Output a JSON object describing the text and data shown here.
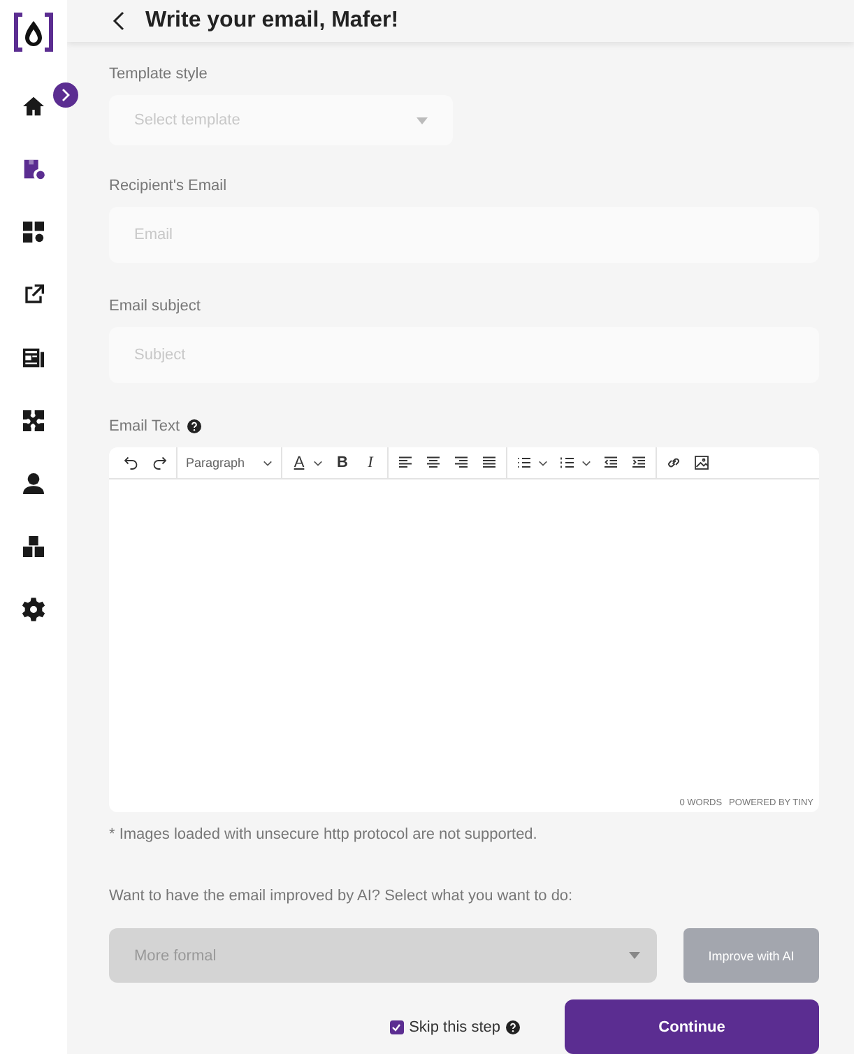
{
  "sidebar": {
    "items": [
      {
        "selected": false
      },
      {
        "selected": true
      },
      {
        "selected": false
      },
      {
        "selected": false
      },
      {
        "selected": false
      },
      {
        "selected": false
      },
      {
        "selected": false
      },
      {
        "selected": false
      },
      {
        "selected": false
      }
    ]
  },
  "header": {
    "title": "Write your email, Mafer!"
  },
  "fields": [
    {
      "kind": "select",
      "label": "Template style",
      "placeholder": "Select template"
    },
    {
      "kind": "input",
      "label": "Recipient's Email",
      "placeholder": "Email"
    },
    {
      "kind": "input",
      "label": "Email subject",
      "placeholder": "Subject"
    }
  ],
  "editor": {
    "label": "Email Text",
    "format": "Paragraph",
    "text_color": "A",
    "bold": "B",
    "italic": "I",
    "word_count": "0 WORDS",
    "branding": "POWERED BY TINY"
  },
  "note": "* Images loaded with unsecure http protocol are not supported.",
  "ai": {
    "prompt": "Want to have the email improved by AI? Select what you want to do:",
    "option": "More formal",
    "select_disabled": true,
    "button": "Improve with AI",
    "button_disabled": true
  },
  "skip": {
    "label": "Skip this step",
    "checked": true
  },
  "continue": "Continue"
}
